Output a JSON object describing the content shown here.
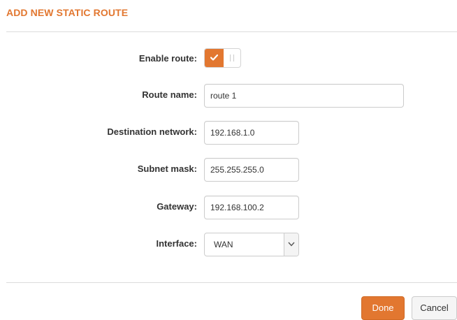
{
  "dialog": {
    "title": "ADD NEW STATIC ROUTE",
    "accent_color": "#e27730"
  },
  "form": {
    "enable_route": {
      "label": "Enable route:",
      "enabled": true
    },
    "route_name": {
      "label": "Route name:",
      "value": "route 1"
    },
    "destination_network": {
      "label": "Destination network:",
      "value": "192.168.1.0"
    },
    "subnet_mask": {
      "label": "Subnet mask:",
      "value": "255.255.255.0"
    },
    "gateway": {
      "label": "Gateway:",
      "value": "192.168.100.2"
    },
    "interface": {
      "label": "Interface:",
      "selected": "WAN"
    }
  },
  "footer": {
    "done_label": "Done",
    "cancel_label": "Cancel"
  },
  "icons": {
    "toggle_on": "checkmark-icon",
    "select": "chevron-down-icon"
  }
}
